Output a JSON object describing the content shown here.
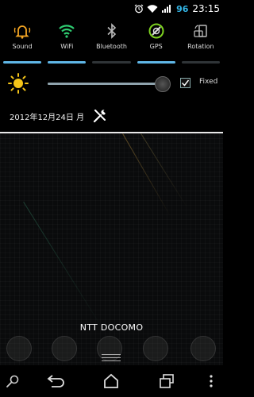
{
  "status_bar": {
    "battery_level": "96",
    "time": "23:15",
    "icons": [
      "alarm-clock-icon",
      "wifi-icon",
      "signal-icon",
      "battery-icon"
    ]
  },
  "quick_settings": [
    {
      "label": "Sound",
      "icon": "bell-icon",
      "state": "on",
      "color": "#f5a623"
    },
    {
      "label": "WiFi",
      "icon": "wifi-icon",
      "state": "on",
      "color": "#2ecc71"
    },
    {
      "label": "Bluetooth",
      "icon": "bluetooth-icon",
      "state": "off",
      "color": "#bbbbbb"
    },
    {
      "label": "GPS",
      "icon": "gps-icon",
      "state": "on",
      "color": "#7ed321"
    },
    {
      "label": "Rotation",
      "icon": "rotation-icon",
      "state": "off",
      "color": "#bbbbbb"
    }
  ],
  "brightness": {
    "level": 0.97,
    "fixed_label": "Fixed",
    "fixed_checked": true
  },
  "date": "2012年12月24日 月",
  "carrier": "NTT DOCOMO",
  "colors": {
    "accent": "#5fb6e6",
    "battery": "#33b5e5"
  }
}
